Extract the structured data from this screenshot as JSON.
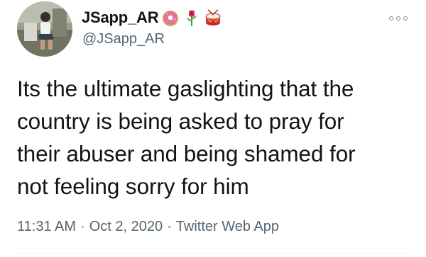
{
  "user": {
    "display_name": "JSapp_AR",
    "handle": "@JSapp_AR",
    "name_emojis": [
      "doughnut-icon",
      "rose-icon",
      "drum-icon"
    ]
  },
  "tweet": {
    "lines": [
      "Its the ultimate gaslighting that the",
      "country is being asked to pray for",
      "their abuser and being shamed for",
      "not feeling sorry for him"
    ],
    "time": "11:31 AM",
    "date": "Oct 2, 2020",
    "source": "Twitter Web App",
    "separator": "·"
  },
  "colors": {
    "text": "#0f1419",
    "secondary": "#536471"
  }
}
